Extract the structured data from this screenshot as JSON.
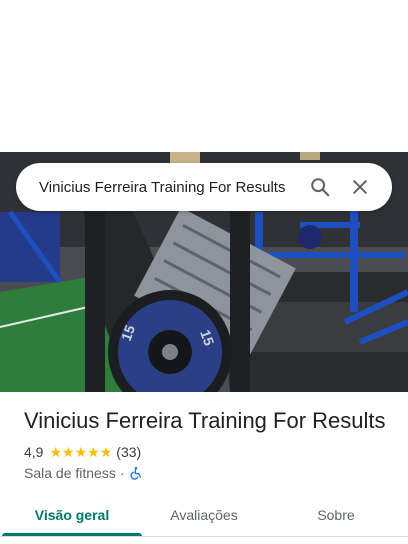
{
  "search": {
    "query": "Vinicius Ferreira Training For Results",
    "search_icon": "search-icon",
    "close_icon": "close-icon"
  },
  "place": {
    "title": "Vinicius Ferreira Training For Results",
    "rating": "4,9",
    "stars": 5,
    "review_count": "(33)",
    "category": "Sala de fitness",
    "separator": "·",
    "accessibility_icon": "wheelchair-icon"
  },
  "tabs": [
    {
      "label": "Visão geral",
      "active": true
    },
    {
      "label": "Avaliações",
      "active": false
    },
    {
      "label": "Sobre",
      "active": false
    }
  ],
  "colors": {
    "accent": "#00796b",
    "star": "#fbbc04",
    "a11y_icon": "#1a73e8"
  }
}
